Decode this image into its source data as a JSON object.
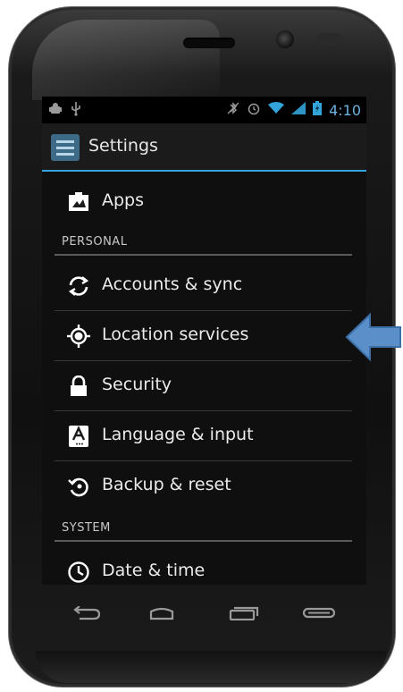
{
  "statusbar": {
    "time": "4:10"
  },
  "actionbar": {
    "title": "Settings"
  },
  "items": [
    {
      "label": "Apps",
      "icon": "apps-icon"
    },
    {
      "label": "Accounts & sync",
      "icon": "sync-icon"
    },
    {
      "label": "Location services",
      "icon": "location-icon"
    },
    {
      "label": "Security",
      "icon": "lock-icon"
    },
    {
      "label": "Language & input",
      "icon": "keyboard-icon"
    },
    {
      "label": "Backup & reset",
      "icon": "backup-icon"
    },
    {
      "label": "Date & time",
      "icon": "clock-icon"
    }
  ],
  "headers": {
    "personal": "PERSONAL",
    "system": "SYSTEM"
  },
  "colors": {
    "accent": "#33a4d9",
    "arrow": "#5b8fc9"
  }
}
